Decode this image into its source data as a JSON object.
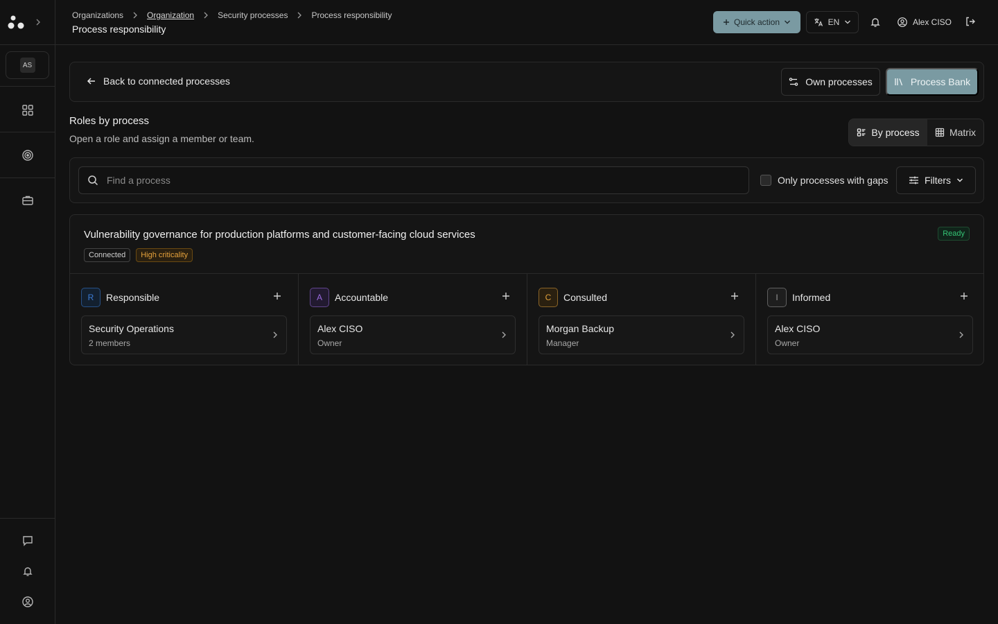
{
  "sidebar": {
    "avatar_initials": "AS",
    "icons": [
      "grid-icon",
      "target-icon",
      "briefcase-icon",
      "chat-icon",
      "bell-icon",
      "user-circle-icon"
    ]
  },
  "topbar": {
    "breadcrumb": [
      "Organizations",
      "Organization",
      "Security processes",
      "Process responsibility"
    ],
    "page_title": "Process responsibility",
    "quick_action_label": "Quick action",
    "language": "EN",
    "user_name": "Alex CISO"
  },
  "toolbar": {
    "back_label": "Back to connected processes",
    "own_processes_label": "Own processes",
    "process_bank_label": "Process Bank"
  },
  "section": {
    "title": "Roles by process",
    "subtitle": "Open a role and assign a member or team.",
    "view_by_process": "By process",
    "view_matrix": "Matrix"
  },
  "filters": {
    "search_placeholder": "Find a process",
    "gaps_label": "Only processes with gaps",
    "filters_label": "Filters"
  },
  "process": {
    "title": "Vulnerability governance for production platforms and customer-facing cloud services",
    "status": "Ready",
    "badges": [
      "Connected",
      "High criticality"
    ],
    "roles": [
      {
        "letter": "R",
        "name": "Responsible",
        "assignee": "Security Operations",
        "detail": "2 members",
        "color": "#3b7bd4",
        "bg": "#13202f"
      },
      {
        "letter": "A",
        "name": "Accountable",
        "assignee": "Alex CISO",
        "detail": "Owner",
        "color": "#9a6be0",
        "bg": "#221a30"
      },
      {
        "letter": "C",
        "name": "Consulted",
        "assignee": "Morgan Backup",
        "detail": "Manager",
        "color": "#e0a03c",
        "bg": "#2a2010"
      },
      {
        "letter": "I",
        "name": "Informed",
        "assignee": "Alex CISO",
        "detail": "Owner",
        "color": "#9a9a9a",
        "bg": "#1e1e1e"
      }
    ]
  },
  "colors": {
    "accent": "#7a9aa2",
    "background": "#121212",
    "ready": "#34c374",
    "critical": "#e6a23c"
  }
}
